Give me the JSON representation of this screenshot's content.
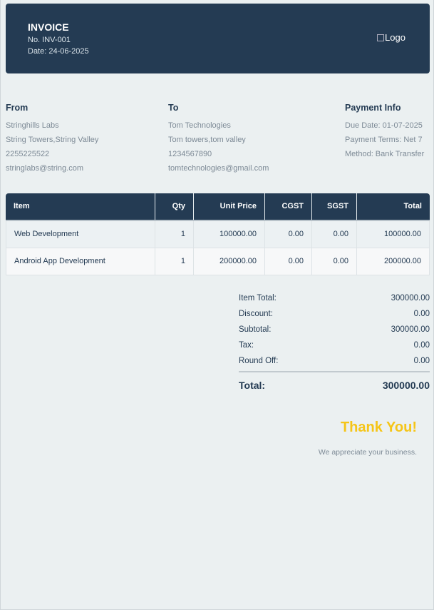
{
  "header": {
    "title": "INVOICE",
    "number": "No. INV-001",
    "date": "Date: 24-06-2025",
    "logo_alt": "Logo"
  },
  "from": {
    "heading": "From",
    "lines": [
      "Stringhills Labs",
      "String Towers,String Valley",
      "2255225522",
      "stringlabs@string.com"
    ]
  },
  "to": {
    "heading": "To",
    "lines": [
      "Tom Technologies",
      "Tom towers,tom valley",
      "1234567890",
      "tomtechnologies@gmail.com"
    ]
  },
  "payment": {
    "heading": "Payment Info",
    "lines": [
      "Due Date: 01-07-2025",
      "Payment Terms: Net 7",
      "Method: Bank Transfer"
    ]
  },
  "table": {
    "headers": {
      "item": "Item",
      "qty": "Qty",
      "unit": "Unit Price",
      "cgst": "CGST",
      "sgst": "SGST",
      "total": "Total"
    },
    "rows": [
      {
        "item": "Web Development",
        "qty": "1",
        "unit": "100000.00",
        "cgst": "0.00",
        "sgst": "0.00",
        "total": "100000.00"
      },
      {
        "item": "Android App Development",
        "qty": "1",
        "unit": "200000.00",
        "cgst": "0.00",
        "sgst": "0.00",
        "total": "200000.00"
      }
    ]
  },
  "totals": {
    "item_total_label": "Item Total:",
    "item_total": "300000.00",
    "discount_label": "Discount:",
    "discount": "0.00",
    "subtotal_label": "Subtotal:",
    "subtotal": "300000.00",
    "tax_label": "Tax:",
    "tax": "0.00",
    "round_off_label": "Round Off:",
    "round_off": "0.00",
    "total_label": "Total:",
    "total": "300000.00"
  },
  "footer": {
    "thanks": "Thank You!",
    "note": "We appreciate your business."
  },
  "colors": {
    "header_bg": "#243b53",
    "accent": "#f5c518"
  }
}
